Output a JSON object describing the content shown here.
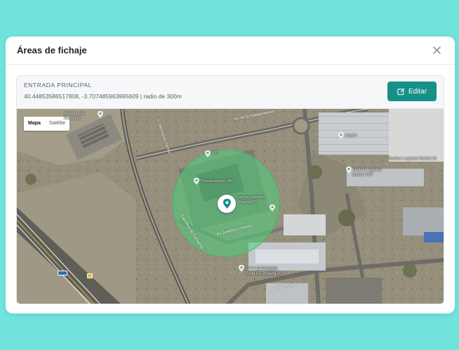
{
  "modal": {
    "title": "Áreas de fichaje",
    "close_icon": "close-icon"
  },
  "area": {
    "name": "ENTRADA PRINCIPAL",
    "coords": "40.44853586517808, -3.707485963995609 | radio de 300m",
    "edit_label": "Editar",
    "edit_icon": "edit-icon"
  },
  "map": {
    "type_map": "Mapa",
    "type_satellite": "Satélite",
    "circle_color": "#4fd07a",
    "marker_color": "#17908a",
    "labels": {
      "valoriza": "Valoriza san",
      "valoriza2": "Fernando",
      "thyssen": "Thyssenkrupp SBO",
      "kuehne_center": "Kuehne Logistics",
      "kuehne_center2": "Madrid 10",
      "kuehne_right": "Kuehne Logistics",
      "kuehne_right2": "Madrid TWT",
      "kuehne_top": "Kuehne Logistics Madrid 10",
      "logwin": "Logwin",
      "ctt": "CTT EXPRESS",
      "ctt2": "SAN FERNANDO",
      "vcl": "VCL",
      "road_indep": "Av. de la Independencia",
      "road_anselmo": "Av. Anselmo Lorenzo",
      "road_sucesor": "Av. Sucesor",
      "road_ctra": "Carretera de Camarma",
      "road_camino": "C. Hermanos Campo",
      "road_r2": "R-2",
      "road_av": "Av. de la Fuente",
      "road_m": "M-50"
    }
  }
}
